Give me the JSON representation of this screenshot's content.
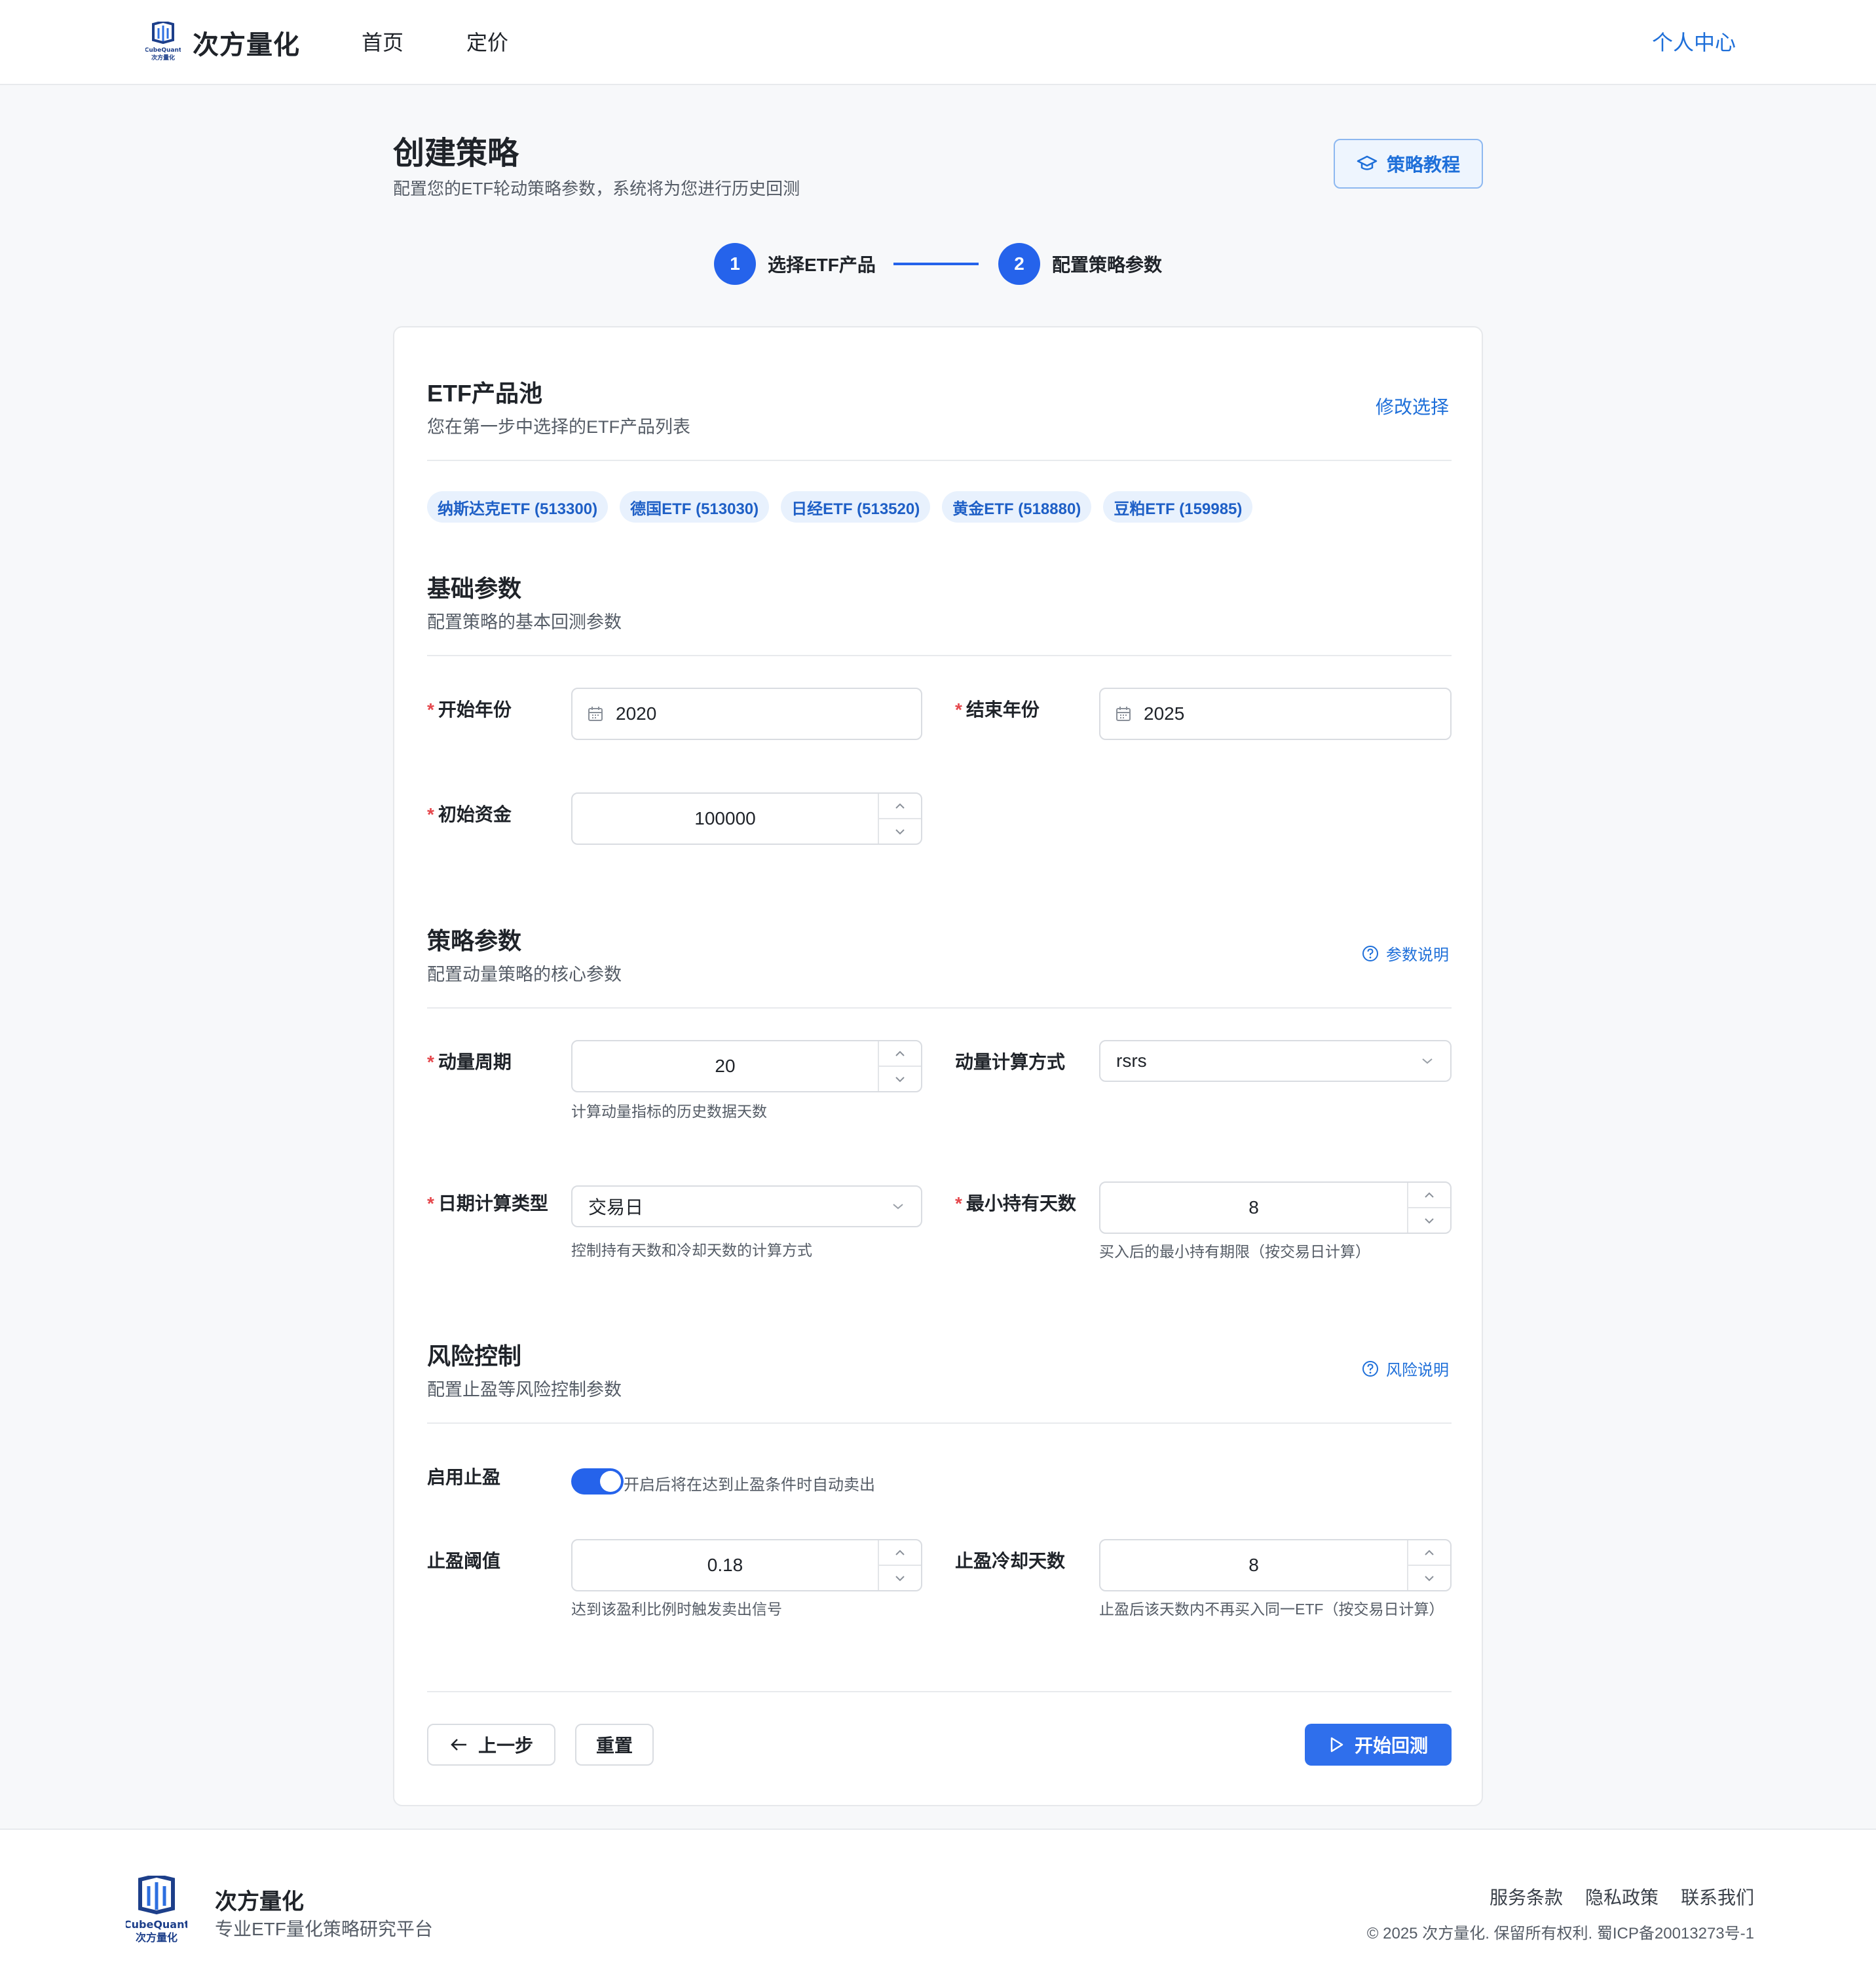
{
  "brand": {
    "name": "次方量化",
    "logo_text_top": "CubeQuant",
    "logo_text_bottom": "次方量化"
  },
  "nav": {
    "home": "首页",
    "pricing": "定价",
    "user_center": "个人中心"
  },
  "page": {
    "title": "创建策略",
    "subtitle": "配置您的ETF轮动策略参数，系统将为您进行历史回测",
    "tutorial_label": "策略教程"
  },
  "steps": [
    {
      "number": "1",
      "label": "选择ETF产品"
    },
    {
      "number": "2",
      "label": "配置策略参数"
    }
  ],
  "etf_pool": {
    "title": "ETF产品池",
    "subtitle": "您在第一步中选择的ETF产品列表",
    "edit_label": "修改选择",
    "tags": [
      "纳斯达克ETF (513300)",
      "德国ETF (513030)",
      "日经ETF (513520)",
      "黄金ETF (518880)",
      "豆粕ETF (159985)"
    ]
  },
  "basic": {
    "title": "基础参数",
    "subtitle": "配置策略的基本回测参数",
    "start_year_label": "开始年份",
    "start_year": "2020",
    "end_year_label": "结束年份",
    "end_year": "2025",
    "capital_label": "初始资金",
    "capital": "100000"
  },
  "strategy": {
    "title": "策略参数",
    "subtitle": "配置动量策略的核心参数",
    "help_label": "参数说明",
    "momentum_period_label": "动量周期",
    "momentum_period": "20",
    "momentum_period_hint": "计算动量指标的历史数据天数",
    "momentum_method_label": "动量计算方式",
    "momentum_method": "rsrs",
    "date_type_label": "日期计算类型",
    "date_type": "交易日",
    "date_type_hint": "控制持有天数和冷却天数的计算方式",
    "min_hold_label": "最小持有天数",
    "min_hold": "8",
    "min_hold_hint": "买入后的最小持有期限（按交易日计算）"
  },
  "risk": {
    "title": "风险控制",
    "subtitle": "配置止盈等风险控制参数",
    "help_label": "风险说明",
    "enable_tp_label": "启用止盈",
    "enable_tp_on": true,
    "enable_tp_hint": "开启后将在达到止盈条件时自动卖出",
    "tp_threshold_label": "止盈阈值",
    "tp_threshold": "0.18",
    "tp_threshold_hint": "达到该盈利比例时触发卖出信号",
    "tp_cooldown_label": "止盈冷却天数",
    "tp_cooldown": "8",
    "tp_cooldown_hint": "止盈后该天数内不再买入同一ETF（按交易日计算）"
  },
  "actions": {
    "prev": "上一步",
    "reset": "重置",
    "start": "开始回测"
  },
  "footer": {
    "name": "次方量化",
    "tagline": "专业ETF量化策略研究平台",
    "links": [
      "服务条款",
      "隐私政策",
      "联系我们"
    ],
    "copyright": "© 2025 次方量化. 保留所有权利. 蜀ICP备20013273号-1"
  },
  "colors": {
    "primary": "#2563eb",
    "link": "#1e6fd9",
    "tag_bg": "#e8f1fd",
    "required": "#e5484d"
  }
}
